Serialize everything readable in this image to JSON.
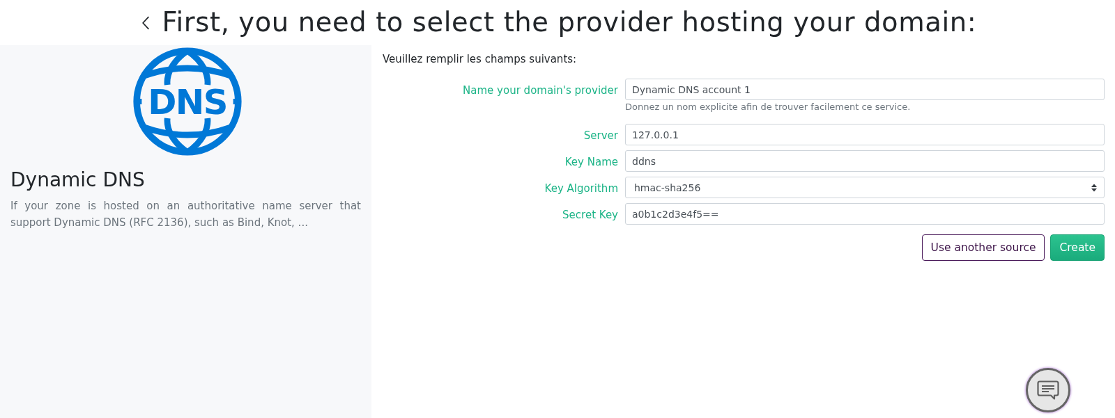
{
  "header": {
    "title": "First, you need to select the provider hosting your domain:"
  },
  "provider": {
    "logo_text": "DNS",
    "name": "Dynamic DNS",
    "description": "If your zone is hosted on an authoritative name server that support Dynamic DNS (RFC 2136), such as Bind, Knot, ..."
  },
  "form": {
    "intro": "Veuillez remplir les champs suivants:",
    "fields": [
      {
        "kind": "text",
        "label": "Name your domain's provider",
        "value": "Dynamic DNS account 1",
        "help": "Donnez un nom explicite afin de trouver facilement ce service."
      },
      {
        "kind": "text",
        "label": "Server",
        "value": "127.0.0.1"
      },
      {
        "kind": "text",
        "label": "Key Name",
        "value": "ddns"
      },
      {
        "kind": "select",
        "label": "Key Algorithm",
        "value": "hmac-sha256"
      },
      {
        "kind": "text",
        "label": "Secret Key",
        "value": "a0b1c2d3e4f5=="
      }
    ],
    "buttons": [
      {
        "kind": "outline",
        "label": "Use another source"
      },
      {
        "kind": "primary",
        "label": "Create"
      }
    ]
  }
}
